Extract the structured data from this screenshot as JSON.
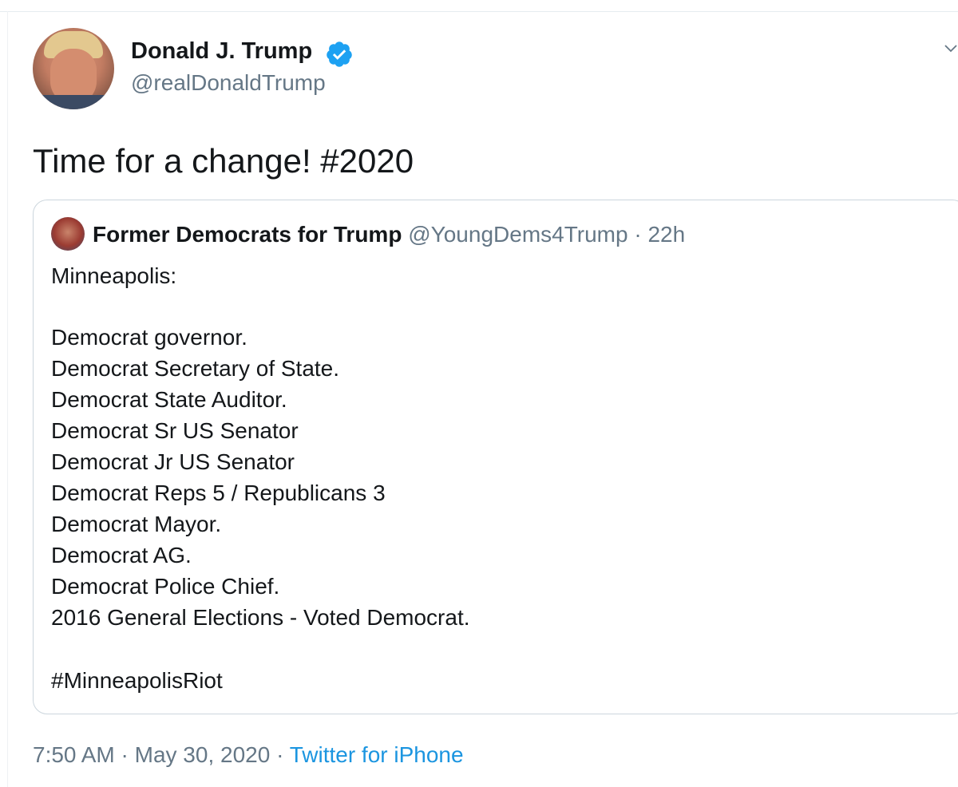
{
  "author": {
    "name": "Donald J. Trump",
    "handle": "@realDonaldTrump",
    "verified_icon": "verified-badge-icon",
    "badge_color": "#1da1f2"
  },
  "tweet": {
    "text": "Time for a change! #2020"
  },
  "quoted": {
    "name": "Former Democrats for Trump",
    "handle": "@YoungDems4Trump",
    "separator": "·",
    "age": "22h",
    "lines": [
      "Minneapolis:",
      "Democrat governor.",
      "Democrat Secretary of State.",
      "Democrat State Auditor.",
      "Democrat Sr US Senator",
      "Democrat Jr US Senator",
      "Democrat Reps 5 / Republicans 3",
      "Democrat Mayor.",
      "Democrat AG.",
      "Democrat Police Chief.",
      "2016 General Elections - Voted Democrat.",
      "#MinneapolisRiot"
    ]
  },
  "footer": {
    "time": "7:50 AM",
    "separator": "·",
    "date": "May 30, 2020",
    "source": "Twitter for iPhone",
    "source_color": "#1b95e0"
  },
  "icons": {
    "menu": "chevron-down-icon"
  }
}
